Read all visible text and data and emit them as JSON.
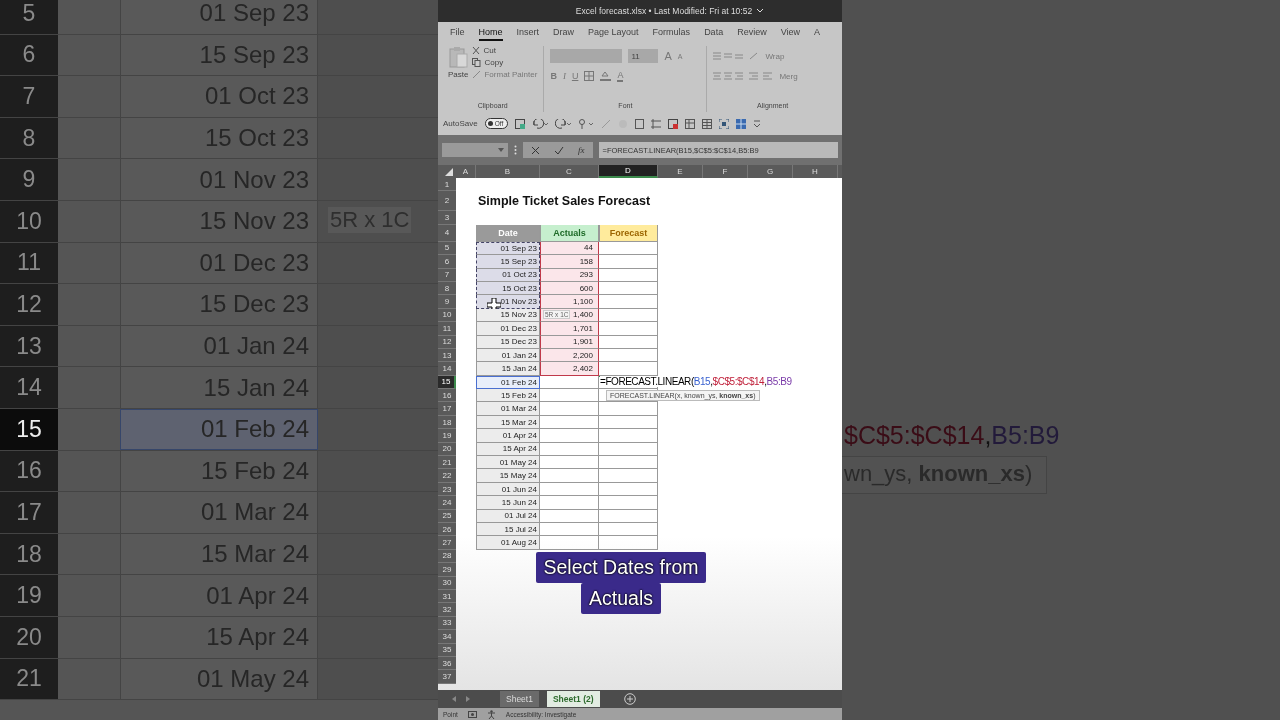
{
  "backdrop_left": {
    "rows": [
      {
        "number": "5",
        "date": "01 Sep 23",
        "selected": false
      },
      {
        "number": "6",
        "date": "15 Sep 23",
        "selected": false
      },
      {
        "number": "7",
        "date": "01 Oct 23",
        "selected": false
      },
      {
        "number": "8",
        "date": "15 Oct 23",
        "selected": false
      },
      {
        "number": "9",
        "date": "01 Nov 23",
        "selected": false
      },
      {
        "number": "10",
        "date": "15 Nov 23",
        "selected": false
      },
      {
        "number": "11",
        "date": "01 Dec 23",
        "selected": false
      },
      {
        "number": "12",
        "date": "15 Dec 23",
        "selected": false
      },
      {
        "number": "13",
        "date": "01 Jan 24",
        "selected": false
      },
      {
        "number": "14",
        "date": "15 Jan 24",
        "selected": false
      },
      {
        "number": "15",
        "date": "01 Feb 24",
        "selected": true
      },
      {
        "number": "16",
        "date": "15 Feb 24",
        "selected": false
      },
      {
        "number": "17",
        "date": "01 Mar 24",
        "selected": false
      },
      {
        "number": "18",
        "date": "15 Mar 24",
        "selected": false
      },
      {
        "number": "19",
        "date": "01 Apr 24",
        "selected": false
      },
      {
        "number": "20",
        "date": "15 Apr 24",
        "selected": false
      },
      {
        "number": "21",
        "date": "01 May 24",
        "selected": false
      }
    ],
    "size_tip": "5R x 1C"
  },
  "title_bar": {
    "title": "Excel forecast.xlsx • Last Modified: Fri at 10:52"
  },
  "ribbon_tabs": [
    {
      "label": "File",
      "selected": false
    },
    {
      "label": "Home",
      "selected": true
    },
    {
      "label": "Insert",
      "selected": false
    },
    {
      "label": "Draw",
      "selected": false
    },
    {
      "label": "Page Layout",
      "selected": false
    },
    {
      "label": "Formulas",
      "selected": false
    },
    {
      "label": "Data",
      "selected": false
    },
    {
      "label": "Review",
      "selected": false
    },
    {
      "label": "View",
      "selected": false
    },
    {
      "label": "A",
      "selected": false
    }
  ],
  "clipboard": {
    "paste": "Paste",
    "cut": "Cut",
    "copy": "Copy",
    "format_painter": "Format Painter",
    "group": "Clipboard"
  },
  "font_group": {
    "size": "11",
    "grow": "A",
    "shrink": "A",
    "bold": "B",
    "italic": "I",
    "underline": "U",
    "font_color": "A",
    "group": "Font"
  },
  "alignment_group": {
    "wrap": "Wrap",
    "merge": "Merg",
    "group": "Alignment"
  },
  "quick_access": {
    "autosave": "AutoSave",
    "toggle": {
      "label": "Off",
      "on": false
    }
  },
  "formula_bar": {
    "function_label": "fx",
    "formula": "=FORECAST.LINEAR(B15,$C$5:$C$14,B5:B9"
  },
  "columns": [
    {
      "label": "A",
      "selected": false
    },
    {
      "label": "B",
      "selected": false
    },
    {
      "label": "C",
      "selected": false
    },
    {
      "label": "D",
      "selected": true
    },
    {
      "label": "E",
      "selected": false
    },
    {
      "label": "F",
      "selected": false
    },
    {
      "label": "G",
      "selected": false
    },
    {
      "label": "H",
      "selected": false
    }
  ],
  "row_headers": [
    {
      "label": "1",
      "selected": false
    },
    {
      "label": "2",
      "selected": false
    },
    {
      "label": "3",
      "selected": false
    },
    {
      "label": "4",
      "selected": false
    },
    {
      "label": "5",
      "selected": false
    },
    {
      "label": "6",
      "selected": false
    },
    {
      "label": "7",
      "selected": false
    },
    {
      "label": "8",
      "selected": false
    },
    {
      "label": "9",
      "selected": false
    },
    {
      "label": "10",
      "selected": false
    },
    {
      "label": "11",
      "selected": false
    },
    {
      "label": "12",
      "selected": false
    },
    {
      "label": "13",
      "selected": false
    },
    {
      "label": "14",
      "selected": false
    },
    {
      "label": "15",
      "selected": true
    },
    {
      "label": "16",
      "selected": false
    },
    {
      "label": "17",
      "selected": false
    },
    {
      "label": "18",
      "selected": false
    },
    {
      "label": "19",
      "selected": false
    },
    {
      "label": "20",
      "selected": false
    },
    {
      "label": "21",
      "selected": false
    },
    {
      "label": "22",
      "selected": false
    },
    {
      "label": "23",
      "selected": false
    },
    {
      "label": "24",
      "selected": false
    },
    {
      "label": "25",
      "selected": false
    },
    {
      "label": "26",
      "selected": false
    },
    {
      "label": "27",
      "selected": false
    },
    {
      "label": "28",
      "selected": false
    },
    {
      "label": "29",
      "selected": false
    },
    {
      "label": "30",
      "selected": false
    },
    {
      "label": "31",
      "selected": false
    },
    {
      "label": "32",
      "selected": false
    },
    {
      "label": "33",
      "selected": false
    },
    {
      "label": "34",
      "selected": false
    },
    {
      "label": "35",
      "selected": false
    },
    {
      "label": "36",
      "selected": false
    },
    {
      "label": "37",
      "selected": false
    }
  ],
  "sheet_title": "Simple Ticket Sales Forecast",
  "table_headers": [
    {
      "label": "Date",
      "kind": "date"
    },
    {
      "label": "Actuals",
      "kind": "actuals"
    },
    {
      "label": "Forecast",
      "kind": "forecast"
    }
  ],
  "data_rows": [
    {
      "date": "01 Sep 23",
      "actual": "44",
      "marquee": true,
      "referenced": false,
      "in_range": true
    },
    {
      "date": "15 Sep 23",
      "actual": "158",
      "marquee": true,
      "referenced": false,
      "in_range": true
    },
    {
      "date": "01 Oct 23",
      "actual": "293",
      "marquee": true,
      "referenced": false,
      "in_range": true
    },
    {
      "date": "15 Oct 23",
      "actual": "600",
      "marquee": true,
      "referenced": false,
      "in_range": true
    },
    {
      "date": "01 Nov 23",
      "actual": "1,100",
      "marquee": true,
      "referenced": false,
      "in_range": true
    },
    {
      "date": "15 Nov 23",
      "actual": "1,400",
      "marquee": false,
      "referenced": false,
      "in_range": true
    },
    {
      "date": "01 Dec 23",
      "actual": "1,701",
      "marquee": false,
      "referenced": false,
      "in_range": true
    },
    {
      "date": "15 Dec 23",
      "actual": "1,901",
      "marquee": false,
      "referenced": false,
      "in_range": true
    },
    {
      "date": "01 Jan 24",
      "actual": "2,200",
      "marquee": false,
      "referenced": false,
      "in_range": true
    },
    {
      "date": "15 Jan 24",
      "actual": "2,402",
      "marquee": false,
      "referenced": false,
      "in_range": true
    },
    {
      "date": "01 Feb 24",
      "marquee": false,
      "referenced": true,
      "in_range": false,
      "formula": [
        {
          "text": "=FORECAST.LINEAR(",
          "color": "#000000"
        },
        {
          "text": "B15",
          "color": "#3a62d0"
        },
        {
          "text": ","
        },
        {
          "text": "$C$5:$C$14",
          "color": "#c0203a"
        },
        {
          "text": ","
        },
        {
          "text": "B5:B9",
          "color": "#7a3aa8"
        }
      ]
    },
    {
      "date": "15 Feb 24",
      "marquee": false,
      "referenced": false,
      "in_range": false
    },
    {
      "date": "01 Mar 24",
      "marquee": false,
      "referenced": false,
      "in_range": false
    },
    {
      "date": "15 Mar 24",
      "marquee": false,
      "referenced": false,
      "in_range": false
    },
    {
      "date": "01 Apr 24",
      "marquee": false,
      "referenced": false,
      "in_range": false
    },
    {
      "date": "15 Apr 24",
      "marquee": false,
      "referenced": false,
      "in_range": false
    },
    {
      "date": "01 May 24",
      "marquee": false,
      "referenced": false,
      "in_range": false
    },
    {
      "date": "15 May 24",
      "marquee": false,
      "referenced": false,
      "in_range": false
    },
    {
      "date": "01 Jun 24",
      "marquee": false,
      "referenced": false,
      "in_range": false
    },
    {
      "date": "15 Jun 24",
      "marquee": false,
      "referenced": false,
      "in_range": false
    },
    {
      "date": "01 Jul 24",
      "marquee": false,
      "referenced": false,
      "in_range": false
    },
    {
      "date": "15 Jul 24",
      "marquee": false,
      "referenced": false,
      "in_range": false
    },
    {
      "date": "01 Aug 24",
      "marquee": false,
      "referenced": false,
      "in_range": false
    }
  ],
  "selection_size_tip": "5R x 1C",
  "function_tooltip": "FORECAST.LINEAR(x, known_ys, **known_xs**)",
  "caption": [
    "Select Dates from",
    "Actuals"
  ],
  "sheet_tabs": [
    {
      "label": "Sheet1",
      "selected": false
    },
    {
      "label": "Sheet1 (2)",
      "selected": true
    }
  ],
  "status_bar": {
    "mode": "Point",
    "accessibility": "Accessibility: Investigate"
  },
  "backdrop_right": {
    "formula_fragment": [
      {
        "text": "$C$5:$C$14",
        "color": "#3a0c16"
      },
      {
        "text": ",",
        "color": "#111111"
      },
      {
        "text": "B5:B9",
        "color": "#221a3a"
      }
    ],
    "tooltip_fragment": "wn_ys, **known_xs**)"
  }
}
